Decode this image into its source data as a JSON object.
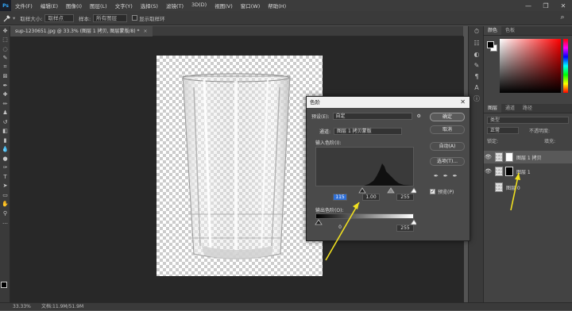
{
  "menubar": {
    "logo": "Ps",
    "items": [
      "文件(F)",
      "编辑(E)",
      "图像(I)",
      "图层(L)",
      "文字(Y)",
      "选择(S)",
      "滤镜(T)",
      "3D(D)",
      "视图(V)",
      "窗口(W)",
      "帮助(H)"
    ],
    "window_controls": [
      "—",
      "❐",
      "✕"
    ]
  },
  "options_bar": {
    "tool_icon": "eyedropper-icon",
    "sample_size_label": "取样大小:",
    "sample_size_value": "取样点",
    "sample_label": "样本:",
    "sample_value": "所有图层",
    "show_ring_label": "显示取样环"
  },
  "document": {
    "tab_title": "sup-1230651.jpg @ 33.3% (图层 1 拷贝, 图层蒙版/8) *",
    "tab_close": "×"
  },
  "status": {
    "zoom": "33.33%",
    "doc": "文档:11.9M/51.9M"
  },
  "right_panel": {
    "color_tabs": [
      "颜色",
      "色板"
    ],
    "layer_tabs": [
      "图层",
      "通道",
      "路径"
    ],
    "kind_label": "类型",
    "mode_value": "正常",
    "opacity_label": "不透明度:",
    "lock_label": "锁定:",
    "fill_label": "填充:",
    "layers": [
      {
        "name": "图层 1 拷贝",
        "selected": true,
        "mask": "white"
      },
      {
        "name": "图层 1",
        "selected": false,
        "mask": "black"
      },
      {
        "name": "图层 0",
        "selected": false,
        "mask": null
      }
    ]
  },
  "levels_dialog": {
    "title": "色阶",
    "close": "✕",
    "preset_label": "预设(E):",
    "preset_value": "自定",
    "channel_label": "通道:",
    "channel_value": "图层 1 拷贝蒙版",
    "input_label": "输入色阶(I):",
    "input_values": [
      "115",
      "1.00",
      "255"
    ],
    "output_label": "输出色阶(O):",
    "output_values": [
      "0",
      "255"
    ],
    "buttons": {
      "ok": "确定",
      "cancel": "取消",
      "auto": "自动(A)",
      "options": "选项(T)..."
    },
    "preview_label": "预览(P)",
    "preview_checked": true
  },
  "colors": {
    "annotation_arrow": "#f0e020",
    "input_highlight": "#2f6fd6"
  }
}
